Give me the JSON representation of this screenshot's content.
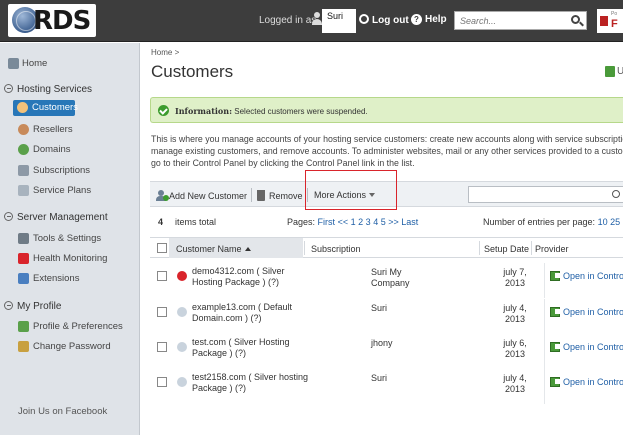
{
  "header": {
    "logo_text": "RDS",
    "logged_in_label": "Logged in as",
    "username": "Suri",
    "logout_label": "Log out",
    "help_label": "Help",
    "search_placeholder": "Search...",
    "partner_small": "Po",
    "partner_letter": "F"
  },
  "sidebar": {
    "home": "Home",
    "groups": [
      {
        "title": "Hosting Services",
        "items": [
          "Customers",
          "Resellers",
          "Domains",
          "Subscriptions",
          "Service Plans"
        ]
      },
      {
        "title": "Server Management",
        "items": [
          "Tools & Settings",
          "Health Monitoring",
          "Extensions"
        ]
      },
      {
        "title": "My Profile",
        "items": [
          "Profile & Preferences",
          "Change Password"
        ]
      }
    ],
    "footer": "Join Us on Facebook"
  },
  "main": {
    "breadcrumb": "Home >",
    "title": "Customers",
    "title_right_letter": "U",
    "message_label": "Information:",
    "message_text": " Selected customers were suspended.",
    "description": [
      "This is where you manage accounts of your hosting service customers: create new accounts along with service subscriptio",
      "manage existing customers, and remove accounts. To administer websites, mail or any other services provided to a custo",
      "go to their Control Panel by clicking the Control Panel link in the list."
    ],
    "toolbar": {
      "add_label": "Add New Customer",
      "remove_label": "Remove",
      "more_label": "More Actions"
    },
    "pager": {
      "count": "4",
      "items_label": "items total",
      "pages_label": "Pages:",
      "first": "First",
      "prev": "<<",
      "pages": [
        "1",
        "2",
        "3",
        "4",
        "5"
      ],
      "next": ">>",
      "last": "Last",
      "entries_label": "Number of entries per page:",
      "entries": [
        "10",
        "25"
      ]
    },
    "table": {
      "headers": [
        "Customer Name",
        "Subscription",
        "Setup Date",
        "Provider"
      ],
      "rows": [
        {
          "name": "demo4312.com ( Silver Hosting Package ) (?)",
          "subscription": "Suri  My Company",
          "date": "july 7, 2013",
          "provider": "Open in Contro",
          "status_color": "#d9242b"
        },
        {
          "name": "example13.com ( Default Domain.com ) (?)",
          "subscription": "Suri",
          "date": "july 4, 2013",
          "provider": "Open in Contro",
          "status_color": "#c9d3dd"
        },
        {
          "name": "test.com ( Silver Hosting Package ) (?)",
          "subscription": "jhony",
          "date": "july 6, 2013",
          "provider": "Open in Contro",
          "status_color": "#c9d3dd"
        },
        {
          "name": "test2158.com ( Silver hosting Package ) (?)",
          "subscription": "Suri",
          "date": "july 4, 2013",
          "provider": "Open in Contro",
          "status_color": "#c9d3dd"
        }
      ]
    }
  }
}
